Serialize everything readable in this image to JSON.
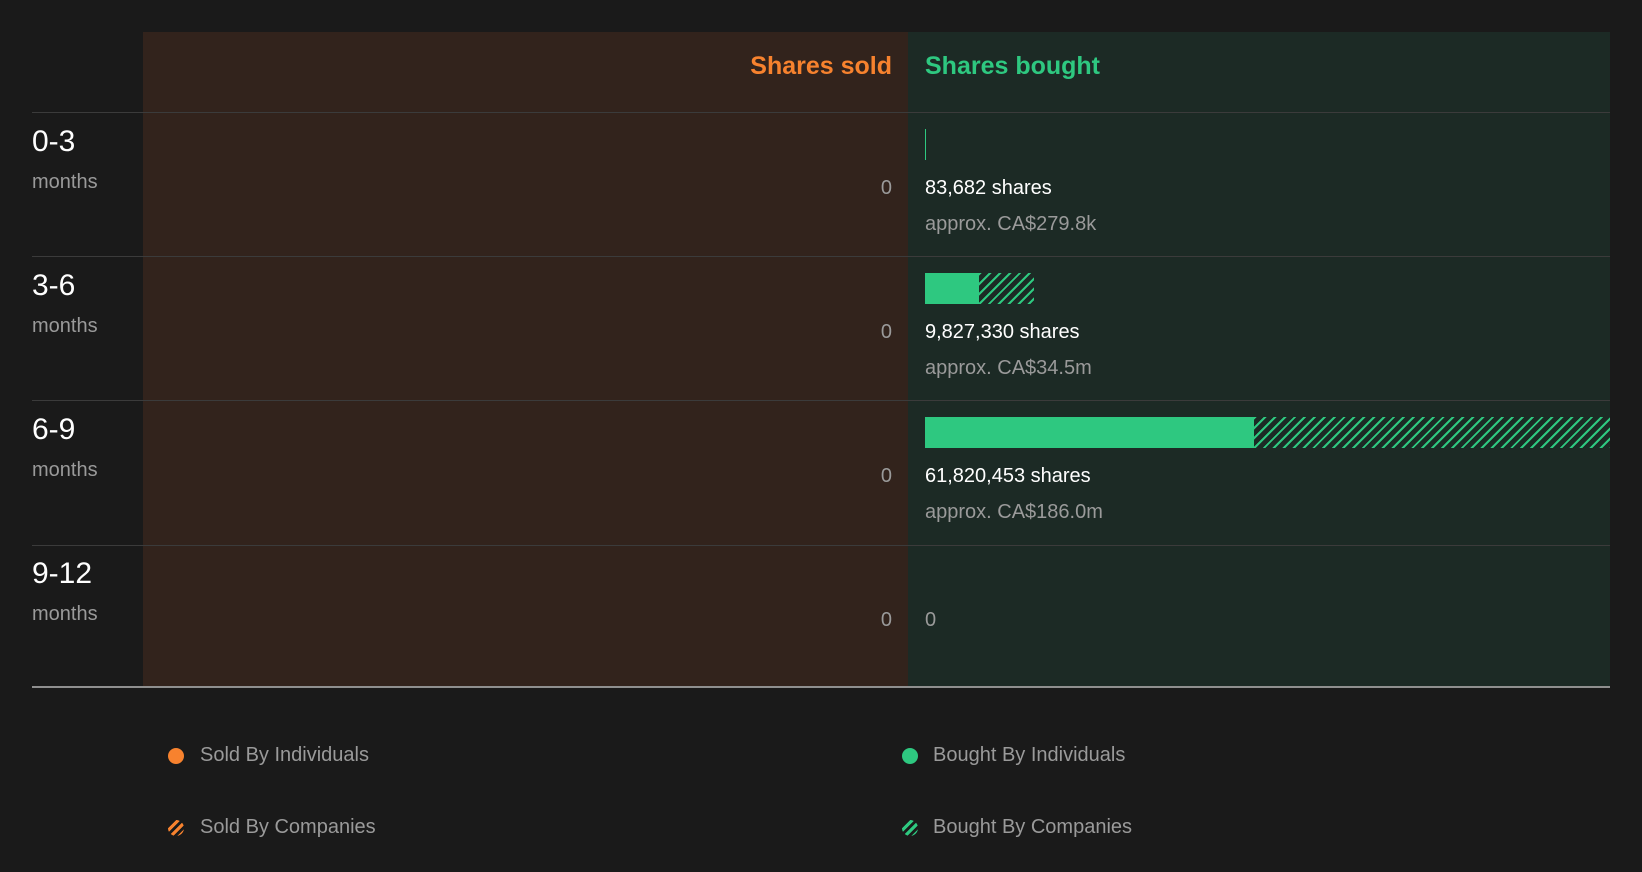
{
  "header": {
    "sold": "Shares sold",
    "bought": "Shares bought"
  },
  "colors": {
    "sold": "#f7822e",
    "bought": "#2ec880",
    "sold_bg": "#32231c",
    "bought_bg": "#1c2a25",
    "page_bg": "#1a1a1a"
  },
  "rows": [
    {
      "range": "0-3",
      "unit": "months",
      "sold": "0",
      "bought_shares": "83,682 shares",
      "bought_approx": "approx. CA$279.8k",
      "bought_zero": ""
    },
    {
      "range": "3-6",
      "unit": "months",
      "sold": "0",
      "bought_shares": "9,827,330 shares",
      "bought_approx": "approx. CA$34.5m",
      "bought_zero": ""
    },
    {
      "range": "6-9",
      "unit": "months",
      "sold": "0",
      "bought_shares": "61,820,453 shares",
      "bought_approx": "approx. CA$186.0m",
      "bought_zero": ""
    },
    {
      "range": "9-12",
      "unit": "months",
      "sold": "0",
      "bought_shares": "",
      "bought_approx": "",
      "bought_zero": "0"
    }
  ],
  "legend": {
    "sold_individuals": "Sold By Individuals",
    "sold_companies": "Sold By Companies",
    "bought_individuals": "Bought By Individuals",
    "bought_companies": "Bought By Companies"
  },
  "chart_data": {
    "type": "bar",
    "orientation": "horizontal",
    "categories": [
      "0-3 months",
      "3-6 months",
      "6-9 months",
      "9-12 months"
    ],
    "max_shares": 61820453,
    "series": [
      {
        "name": "Sold By Individuals",
        "values": [
          0,
          0,
          0,
          0
        ]
      },
      {
        "name": "Sold By Companies",
        "values": [
          0,
          0,
          0,
          0
        ]
      },
      {
        "name": "Bought By Individuals",
        "values": [
          83682,
          4900000,
          29700000,
          0
        ]
      },
      {
        "name": "Bought By Companies",
        "values": [
          0,
          4927330,
          32120453,
          0
        ]
      }
    ]
  }
}
